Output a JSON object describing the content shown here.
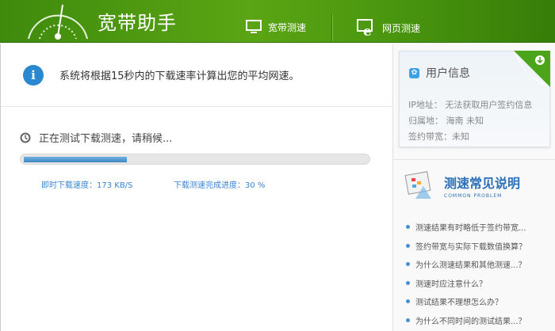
{
  "header": {
    "app_title": "宽带助手",
    "tabs": [
      {
        "label": "宽带测速",
        "icon": "monitor-icon"
      },
      {
        "label": "网页测速",
        "icon": "ie-browser-icon"
      }
    ]
  },
  "main": {
    "notice": "系统将根据15秒内的下载速率计算出您的平均网速。",
    "status": "正在测试下载测速，请稍候...",
    "progress_percent": 30,
    "speed_label": "即时下载速度：173 KB/S",
    "progress_label": "下载测速完成进度：30 %"
  },
  "user_info": {
    "title": "用户信息",
    "ip": "IP地址： 无法获取用户签约信息",
    "location": "归属地： 海南 未知",
    "bandwidth": "签约带宽：未知"
  },
  "faq": {
    "title": "测速常见说明",
    "subtitle": "COMMON PROBLEM",
    "items": [
      "测速结果有时略低于签约带宽...",
      "签约带宽与实际下载数值换算？",
      "为什么测速结果和其他测速...？",
      "测速时应注意什么？",
      "测试结果不理想怎么办？",
      "为什么不同时间的测试结果...？"
    ]
  },
  "colors": {
    "header": "#4a960f",
    "accent": "#3a86d4"
  }
}
